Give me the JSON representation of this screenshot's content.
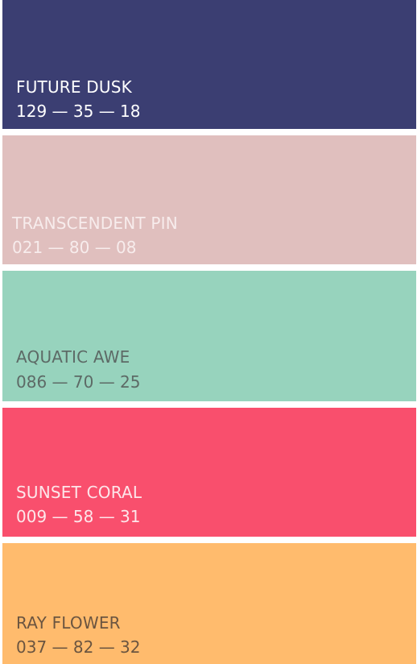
{
  "swatches": [
    {
      "name": "FUTURE DUSK",
      "code": "129 — 35 — 18",
      "color": "#3b3e72",
      "text_color": "#ffffff"
    },
    {
      "name": "TRANSCENDENT PIN",
      "code": "021 — 80 — 08",
      "color": "#e0bfbe",
      "text_color": "#f7ecec"
    },
    {
      "name": "AQUATIC AWE",
      "code": "086 — 70 — 25",
      "color": "#97d3bd",
      "text_color": "#5d6a66"
    },
    {
      "name": "SUNSET CORAL",
      "code": "009 — 58 — 31",
      "color": "#f94f6d",
      "text_color": "#fde6ea"
    },
    {
      "name": "RAY FLOWER",
      "code": "037 — 82 — 32",
      "color": "#ffbb6d",
      "text_color": "#6b5540"
    }
  ]
}
